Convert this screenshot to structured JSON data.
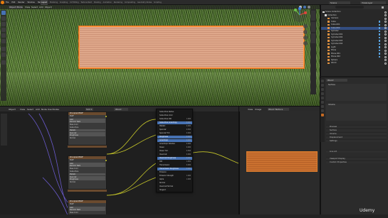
{
  "topbar": {
    "menus": [
      "File",
      "Edit",
      "Render",
      "Window",
      "Help"
    ],
    "workspaces": [
      "Layout",
      "Modeling",
      "Sculpting",
      "UV Editing",
      "Texture Paint",
      "Shading",
      "Animation",
      "Rendering",
      "Compositing",
      "Geometry Nodes",
      "Scripting"
    ],
    "active_workspace": "Layout",
    "scene": "Scene",
    "view_layer": "ViewLayer"
  },
  "viewport": {
    "header_items": [
      "Object Mode",
      "View",
      "Select",
      "Add",
      "Object"
    ],
    "side_tabs": [
      "Item",
      "Tool",
      "View"
    ]
  },
  "outliner": {
    "rows": [
      {
        "label": "Scene Collection",
        "selected": false
      },
      {
        "label": "Collection",
        "selected": false
      },
      {
        "label": "Camera",
        "selected": false
      },
      {
        "label": "Cube",
        "selected": false
      },
      {
        "label": "Cube.001",
        "selected": false
      },
      {
        "label": "Cube.002",
        "selected": true
      },
      {
        "label": "Cylinder",
        "selected": false
      },
      {
        "label": "Cylinder.001",
        "selected": false
      },
      {
        "label": "Cylinder.002",
        "selected": false
      },
      {
        "label": "Cylinder.003",
        "selected": false
      },
      {
        "label": "Cylinder.004",
        "selected": false
      },
      {
        "label": "Light",
        "selected": false
      },
      {
        "label": "Plane",
        "selected": false
      },
      {
        "label": "Plane.001",
        "selected": false
      },
      {
        "label": "Plane.002",
        "selected": false
      },
      {
        "label": "Sphere",
        "selected": false
      },
      {
        "label": "World",
        "selected": false
      }
    ]
  },
  "properties": {
    "material": "Wood",
    "panels": [
      "Surface",
      "Volume",
      "Settings"
    ],
    "rows": [
      "Preview",
      "Surface",
      "Volume",
      "Displacement",
      "Settings",
      "Line Art",
      "Viewport Display",
      "Custom Properties"
    ]
  },
  "node_editor": {
    "header_items": [
      "Object",
      "View",
      "Select",
      "Add",
      "Node",
      "Use Nodes"
    ],
    "slot": "Slot 1",
    "material": "Wood",
    "nodes": [
      {
        "title": "Principled BSDF",
        "rows": [
          "BSDF",
          "GGX",
          "Random Walk",
          "Base Color",
          "Subsurface",
          "Metallic",
          "Specular",
          "Roughness",
          "Normal"
        ]
      },
      {
        "title": "Principled BSDF",
        "rows": [
          "BSDF",
          "GGX",
          "Random Walk",
          "Base Color",
          "Subsurface",
          "Metallic",
          "Specular",
          "Roughness",
          "Normal"
        ]
      },
      {
        "title": "Principled BSDF",
        "rows": [
          "BSDF",
          "GGX",
          "Random Walk",
          "Base Color",
          "Subsurface",
          "Metallic",
          "Roughness"
        ]
      }
    ]
  },
  "popup_menu": {
    "items": [
      {
        "label": "Subsurface Radius",
        "value": ""
      },
      {
        "label": "Subsurface Color",
        "value": ""
      },
      {
        "label": "Subsurface IOR",
        "value": "1.400"
      },
      {
        "label": "Subsurface Anisotropy",
        "value": "0.000"
      },
      {
        "label": "Metallic",
        "value": "0.000"
      },
      {
        "label": "Specular",
        "value": "0.500"
      },
      {
        "label": "Specular Tint",
        "value": "0.000"
      },
      {
        "label": "Roughness",
        "value": "0.500"
      },
      {
        "label": "Anisotropic",
        "value": "0.000"
      },
      {
        "label": "Anisotropic Rotation",
        "value": "0.000"
      },
      {
        "label": "Sheen",
        "value": "0.000"
      },
      {
        "label": "Sheen Tint",
        "value": "0.500"
      },
      {
        "label": "Clearcoat",
        "value": "0.000"
      },
      {
        "label": "Clearcoat Roughness",
        "value": "0.030"
      },
      {
        "label": "IOR",
        "value": "1.450"
      },
      {
        "label": "Transmission",
        "value": "0.000"
      },
      {
        "label": "Transmission Roughness",
        "value": "0.000"
      },
      {
        "label": "Emission",
        "value": ""
      },
      {
        "label": "Emission Strength",
        "value": "1.000"
      },
      {
        "label": "Alpha",
        "value": "1.000"
      },
      {
        "label": "Normal",
        "value": ""
      },
      {
        "label": "Clearcoat Normal",
        "value": ""
      },
      {
        "label": "Tangent",
        "value": ""
      }
    ],
    "highlighted": [
      3,
      7,
      8,
      13,
      16
    ]
  },
  "image_editor": {
    "header_items": [
      "View",
      "Image"
    ],
    "image_name": "Wood Texture"
  },
  "watermark": "Udemy",
  "colors": {
    "accent": "#4772b3",
    "selection": "#334d80",
    "object_outline": "#e56d1f",
    "node_link_yellow": "#c7c729",
    "node_link_purple": "#6a5acd"
  }
}
